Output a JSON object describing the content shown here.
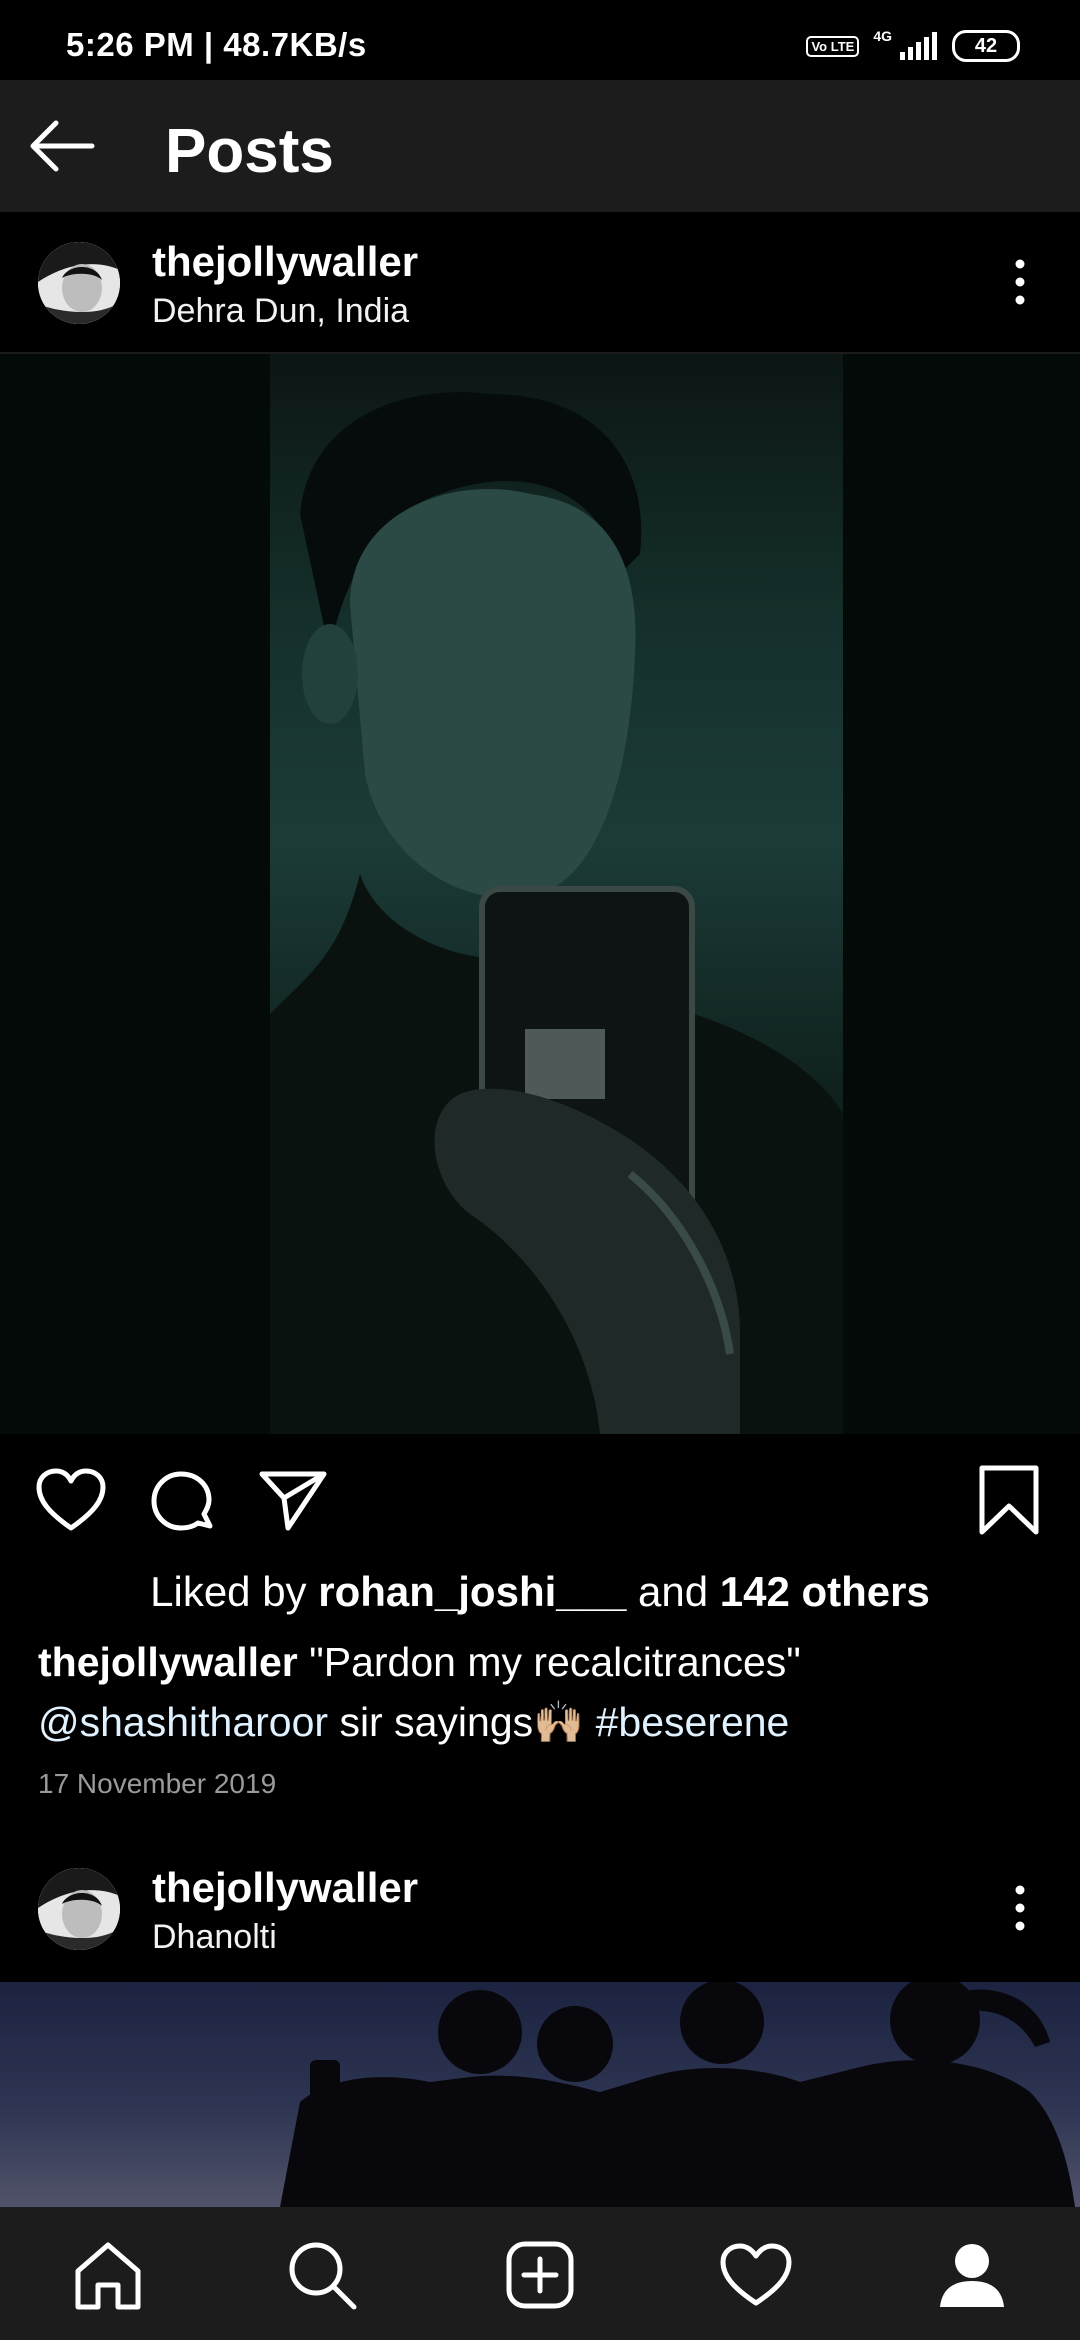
{
  "status_bar": {
    "time_speed": "5:26 PM | 48.7KB/s",
    "volte_label": "Vo LTE",
    "network_label": "4G",
    "battery_level": "42"
  },
  "app_bar": {
    "title": "Posts",
    "back_icon": "arrow-left-icon"
  },
  "post": {
    "username": "thejollywaller",
    "location": "Dehra Dun, India",
    "actions": [
      "heart-icon",
      "comment-icon",
      "share-icon",
      "bookmark-icon"
    ],
    "likes_prefix": "Liked by",
    "liked_by_user": "rohan_joshi___",
    "likes_mid": "and",
    "likes_others": "142 others",
    "caption_user": "thejollywaller",
    "caption_text": "\"Pardon my recalcitrances\"",
    "caption_mention": "@shashitharoor",
    "caption_text2": "sir sayings",
    "caption_emoji": "🙌🏼",
    "caption_hashtag": "#beserene",
    "date": "17 November 2019"
  },
  "post2": {
    "username": "thejollywaller",
    "location": "Dhanolti"
  },
  "bottom_nav": [
    "home-icon",
    "search-icon",
    "add-post-icon",
    "activity-heart-icon",
    "profile-icon"
  ],
  "colors": {
    "background": "#000000",
    "bar": "#1c1c1c",
    "link": "#e0f1ff",
    "muted": "#9a9a9a"
  }
}
